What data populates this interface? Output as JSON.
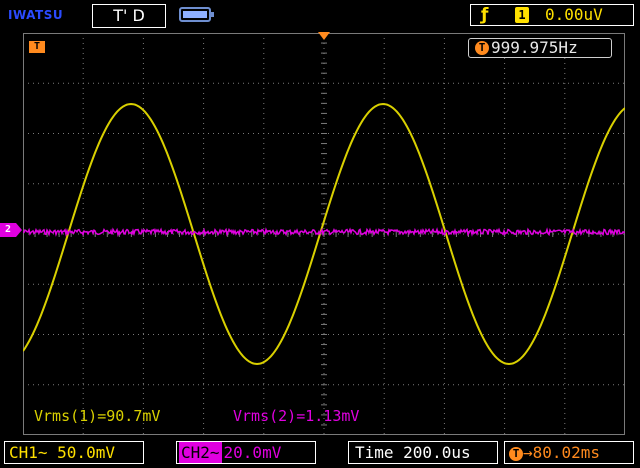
{
  "header": {
    "brand": "IWATSU",
    "run_status": "T' D",
    "trigger": {
      "edge_icon": "rising-edge-icon",
      "source_badge": "1",
      "level": "0.00uV"
    }
  },
  "screen": {
    "frequency_readout": {
      "icon": "T",
      "value": "999.975Hz"
    },
    "markers": {
      "trigger_position": "T",
      "ch2_ground": "2"
    },
    "measurements": {
      "ch1": "Vrms(1)=90.7mV",
      "ch2": "Vrms(2)=1.13mV"
    }
  },
  "footer": {
    "ch1_scale": "CH1∼ 50.0mV",
    "ch2_tag": "CH2∼",
    "ch2_scale": "20.0mV",
    "timebase": "Time 200.0us",
    "trigger_delay_icon": "T",
    "trigger_delay": "→80.02ms"
  },
  "colors": {
    "ch1": "#d9d000",
    "ch2": "#e000e0",
    "trigger": "#ff8a1e",
    "grid": "#7a7a7a",
    "brand": "#2b4bff"
  }
}
